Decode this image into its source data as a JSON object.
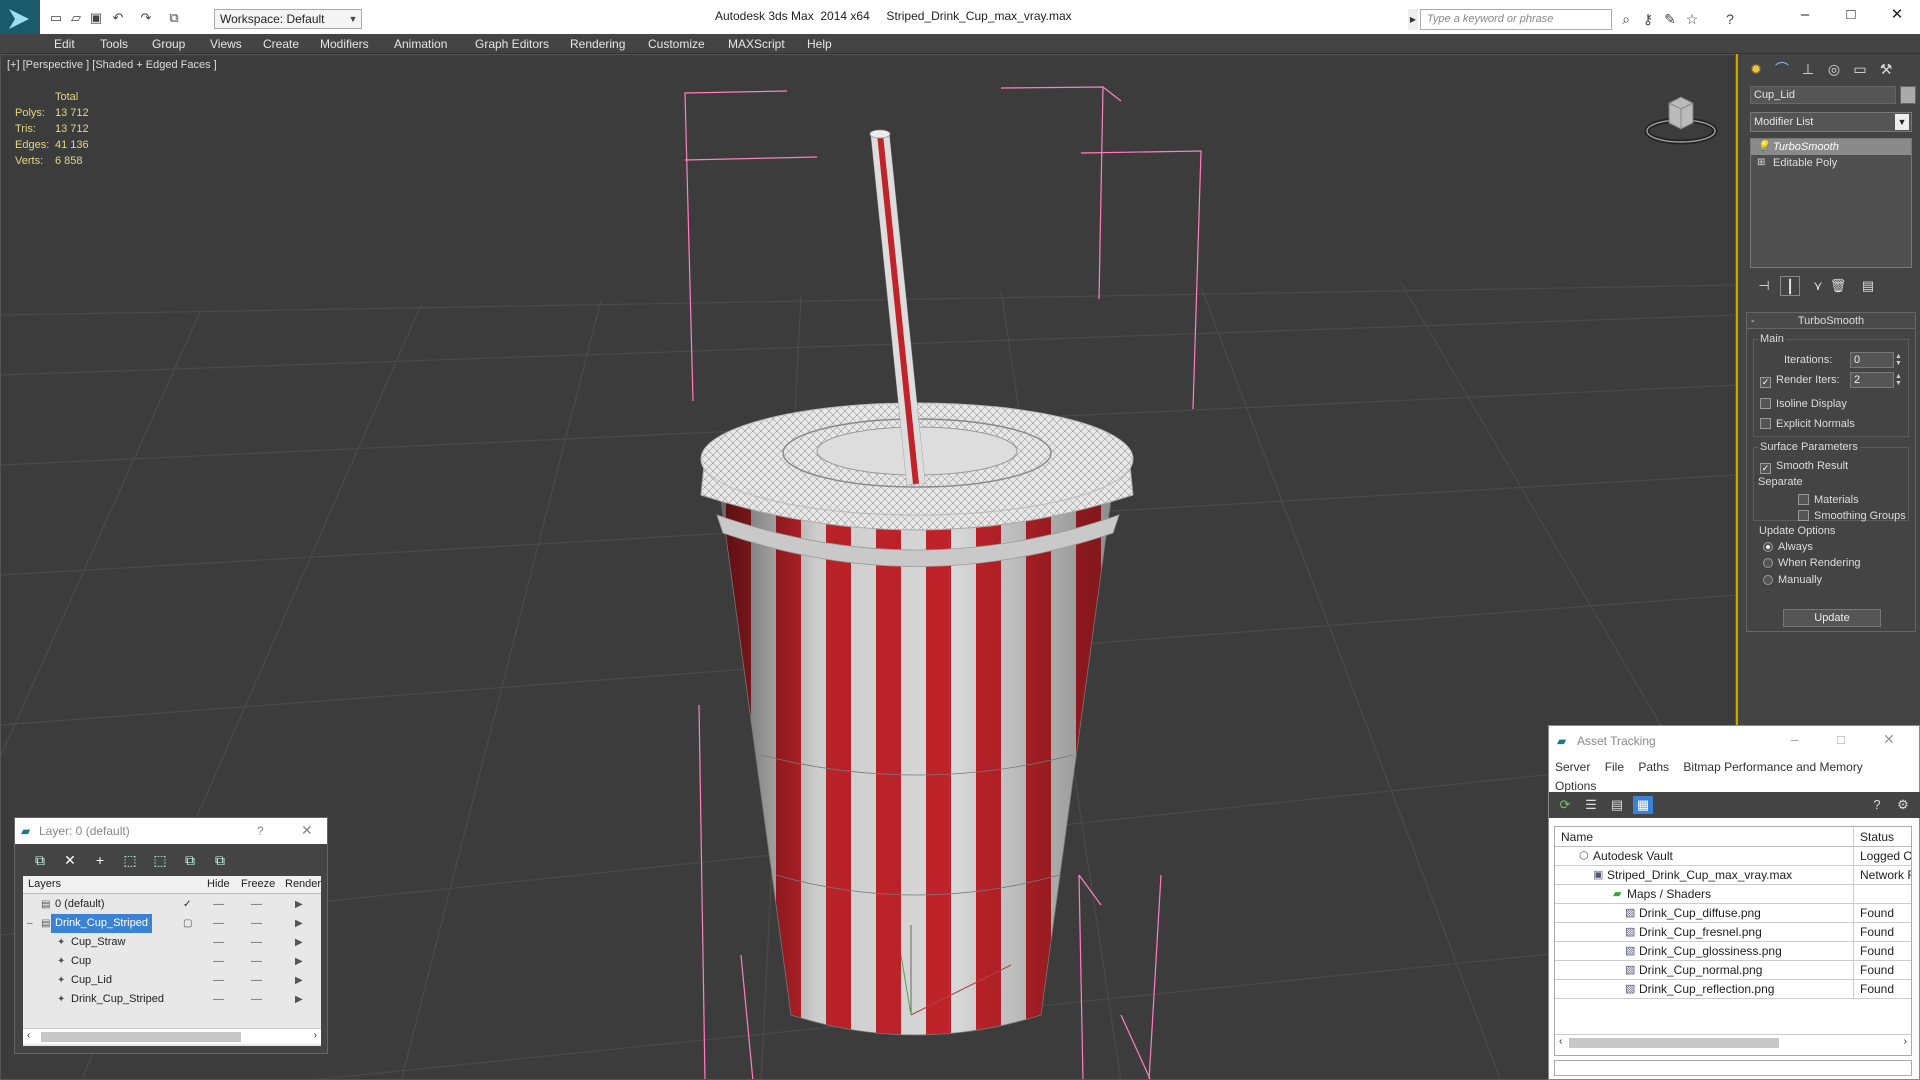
{
  "titlebar": {
    "workspace": "Workspace: Default",
    "window_title": "Autodesk 3ds Max  2014 x64     Striped_Drink_Cup_max_vray.max",
    "search_placeholder": "Type a keyword or phrase"
  },
  "menu": [
    "Edit",
    "Tools",
    "Group",
    "Views",
    "Create",
    "Modifiers",
    "Animation",
    "Graph Editors",
    "Rendering",
    "Customize",
    "MAXScript",
    "Help"
  ],
  "viewport": {
    "label": "[+] [Perspective ] [Shaded + Edged Faces ]",
    "stats": {
      "header": "Total",
      "rows": [
        {
          "label": "Polys:",
          "value": "13 712"
        },
        {
          "label": "Tris:",
          "value": "13 712"
        },
        {
          "label": "Edges:",
          "value": "41 136"
        },
        {
          "label": "Verts:",
          "value": "6 858"
        }
      ]
    },
    "cup_colors": {
      "red": "#c0232a",
      "white": "#d9d9d9",
      "selection_bracket": "#ff80c0"
    }
  },
  "command_panel": {
    "object_name": "Cup_Lid",
    "modifier_list": "Modifier List",
    "stack": [
      {
        "label": "TurboSmooth",
        "selected": true,
        "icon": "lightbulb-icon"
      },
      {
        "label": "Editable Poly",
        "selected": false,
        "icon": "plus-icon"
      }
    ],
    "rollout": {
      "title": "TurboSmooth",
      "main": {
        "title": "Main",
        "iterations_label": "Iterations:",
        "iterations_value": "0",
        "render_iters_label": "Render Iters:",
        "render_iters_value": "2",
        "render_iters_checked": true,
        "isoline_label": "Isoline Display",
        "explicit_label": "Explicit Normals"
      },
      "surface": {
        "title": "Surface Parameters",
        "smooth_result": "Smooth Result",
        "separate": "Separate",
        "materials": "Materials",
        "smoothing_groups": "Smoothing Groups"
      },
      "update": {
        "title": "Update Options",
        "always": "Always",
        "when_rendering": "When Rendering",
        "manually": "Manually",
        "button": "Update"
      }
    }
  },
  "layer_window": {
    "title": "Layer: 0 (default)",
    "help": "?",
    "columns": {
      "layers": "Layers",
      "hide": "Hide",
      "freeze": "Freeze",
      "render": "Render"
    },
    "rows": [
      {
        "name": "0 (default)",
        "indent": 0,
        "selected": false
      },
      {
        "name": "Drink_Cup_Striped",
        "indent": 0,
        "selected": true
      },
      {
        "name": "Cup_Straw",
        "indent": 1,
        "selected": false
      },
      {
        "name": "Cup",
        "indent": 1,
        "selected": false
      },
      {
        "name": "Cup_Lid",
        "indent": 1,
        "selected": false
      },
      {
        "name": "Drink_Cup_Striped",
        "indent": 1,
        "selected": false
      }
    ]
  },
  "asset_window": {
    "title": "Asset Tracking",
    "menu": [
      "Server",
      "File",
      "Paths",
      "Bitmap Performance and Memory",
      "Options"
    ],
    "columns": {
      "name": "Name",
      "status": "Status"
    },
    "rows": [
      {
        "name": "Autodesk Vault",
        "status": "Logged O",
        "indent": 0
      },
      {
        "name": "Striped_Drink_Cup_max_vray.max",
        "status": "Network F",
        "indent": 1
      },
      {
        "name": "Maps / Shaders",
        "status": "",
        "indent": 2
      },
      {
        "name": "Drink_Cup_diffuse.png",
        "status": "Found",
        "indent": 3
      },
      {
        "name": "Drink_Cup_fresnel.png",
        "status": "Found",
        "indent": 3
      },
      {
        "name": "Drink_Cup_glossiness.png",
        "status": "Found",
        "indent": 3
      },
      {
        "name": "Drink_Cup_normal.png",
        "status": "Found",
        "indent": 3
      },
      {
        "name": "Drink_Cup_reflection.png",
        "status": "Found",
        "indent": 3
      }
    ]
  }
}
